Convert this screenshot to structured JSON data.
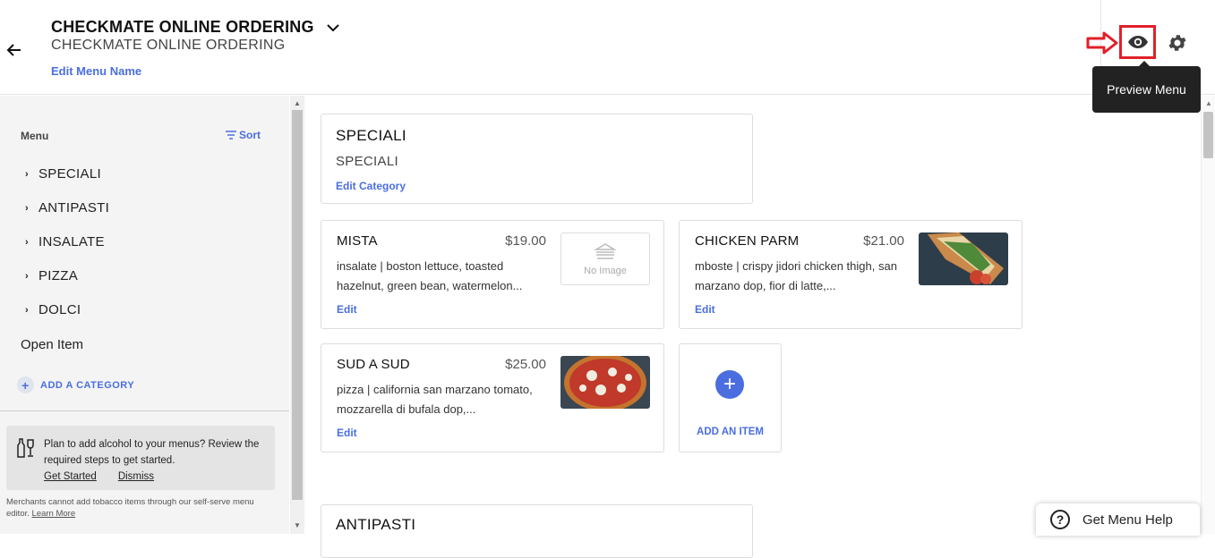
{
  "header": {
    "title": "CHECKMATE ONLINE ORDERING",
    "subtitle": "CHECKMATE ONLINE ORDERING",
    "edit_menu_name": "Edit Menu Name",
    "preview_tooltip": "Preview Menu"
  },
  "sidebar": {
    "menu_label": "Menu",
    "sort_label": "Sort",
    "categories": [
      {
        "label": "SPECIALI"
      },
      {
        "label": "ANTIPASTI"
      },
      {
        "label": "INSALATE"
      },
      {
        "label": "PIZZA"
      },
      {
        "label": "DOLCI"
      }
    ],
    "open_item": "Open Item",
    "add_category": "ADD A CATEGORY",
    "alcohol_notice": {
      "text": "Plan to add alcohol to your menus? Review the required steps to get started.",
      "get_started": "Get Started",
      "dismiss": "Dismiss"
    },
    "tobacco_notice": "Merchants cannot add tobacco items through our self-serve menu editor.",
    "learn_more": "Learn More"
  },
  "main": {
    "category_card": {
      "name": "SPECIALI",
      "subname": "SPECIALI",
      "edit_label": "Edit Category"
    },
    "items": [
      {
        "name": "MISTA",
        "price": "$19.00",
        "description": "insalate | boston lettuce, toasted hazelnut, green bean, watermelon...",
        "edit": "Edit",
        "image": "none",
        "no_image_text": "No Image"
      },
      {
        "name": "CHICKEN PARM",
        "price": "$21.00",
        "description": "mboste | crispy jidori chicken thigh, san marzano dop, fior di latte,...",
        "edit": "Edit",
        "image": "chicken-parm-photo"
      },
      {
        "name": "SUD A SUD",
        "price": "$25.00",
        "description": "pizza | california san marzano tomato, mozzarella di bufala dop,...",
        "edit": "Edit",
        "image": "pizza-photo"
      }
    ],
    "add_item_label": "ADD AN ITEM",
    "next_category": "ANTIPASTI"
  },
  "help": {
    "label": "Get Menu Help"
  },
  "colors": {
    "accent": "#4a6ee0",
    "annotation_red": "#e0202a",
    "tooltip_bg": "#222222"
  }
}
